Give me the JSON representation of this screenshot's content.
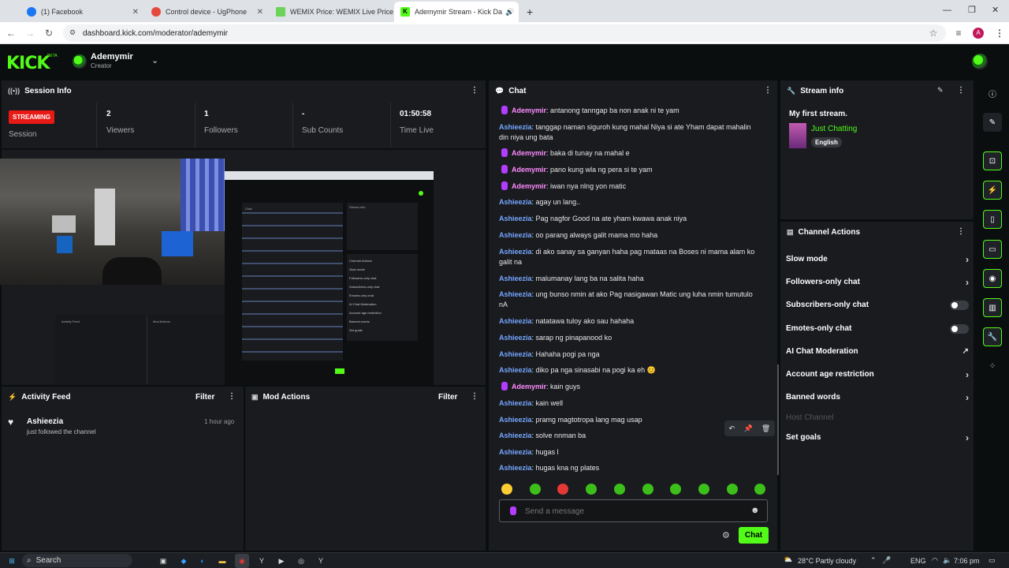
{
  "browser": {
    "tabs": [
      {
        "title": "(1) Facebook",
        "color": "#1877f2"
      },
      {
        "title": "Control device - UgPhone",
        "color": "#e64a3c"
      },
      {
        "title": "WEMIX Price: WEMIX Live Price",
        "color": "#6bd25a"
      },
      {
        "title": "Ademymir Stream - Kick Da",
        "color": "#53fc18"
      }
    ],
    "new_tab": "+",
    "url": "dashboard.kick.com/moderator/ademymir",
    "profile_initial": "A"
  },
  "header": {
    "logo": "KICK",
    "beta": "BETA",
    "channel_name": "Ademymir",
    "role": "Creator"
  },
  "session": {
    "title": "Session Info",
    "badge": "STREAMING",
    "session_label": "Session",
    "viewers_value": "2",
    "viewers_label": "Viewers",
    "followers_value": "1",
    "followers_label": "Followers",
    "subs_value": "-",
    "subs_label": "Sub Counts",
    "time_value": "01:50:58",
    "time_label": "Time Live"
  },
  "preview": {
    "mini_lines": [
      "Chat",
      "Stream info",
      "Channel Actions",
      "Activity Feed",
      "Mod Actions",
      "Slow mode",
      "Followers-only chat",
      "Subscribers-only chat",
      "Emotes-only chat",
      "AI Chat Moderation",
      "Account age restriction",
      "Banned words",
      "Set goals"
    ]
  },
  "activity": {
    "title": "Activity Feed",
    "filter": "Filter",
    "item_user": "Ashieezia",
    "item_time": "1 hour ago",
    "item_text": "just followed the channel"
  },
  "modactions": {
    "title": "Mod Actions",
    "filter": "Filter"
  },
  "chat": {
    "title": "Chat",
    "messages": [
      {
        "user": "Ademymir",
        "text": "antanong tanngap ba non anak ni te yam",
        "mod": true
      },
      {
        "user": "Ashieezia",
        "text": "tanggap naman siguroh kung mahal Niya si ate Yham dapat mahalin din niya ung bata",
        "mod": false
      },
      {
        "user": "Ademymir",
        "text": "baka di tunay na mahal e",
        "mod": true
      },
      {
        "user": "Ademymir",
        "text": "pano kung wla ng pera si te yam",
        "mod": true
      },
      {
        "user": "Ademymir",
        "text": "iwan nya nlng yon matic",
        "mod": true
      },
      {
        "user": "Ashieezia",
        "text": "agay un lang..",
        "mod": false
      },
      {
        "user": "Ashieezia",
        "text": "Pag nagfor Good na ate yham kwawa anak niya",
        "mod": false
      },
      {
        "user": "Ashieezia",
        "text": "oo parang always galit mama mo haha",
        "mod": false
      },
      {
        "user": "Ashieezia",
        "text": "di ako sanay sa ganyan haha pag mataas na Boses ni mama alam ko galit na",
        "mod": false
      },
      {
        "user": "Ashieezia",
        "text": "malumanay lang ba na salita haha",
        "mod": false
      },
      {
        "user": "Ashieezia",
        "text": "ung bunso nmin at ako Pag nasigawan Matic ung luha nmin tumutulo nA",
        "mod": false
      },
      {
        "user": "Ashieezia",
        "text": "natatawa tuloy ako sau hahaha",
        "mod": false
      },
      {
        "user": "Ashieezia",
        "text": "sarap ng pinapanood ko",
        "mod": false
      },
      {
        "user": "Ashieezia",
        "text": "Hahaha pogi pa nga",
        "mod": false
      },
      {
        "user": "Ashieezia",
        "text": "diko pa nga sinasabi na pogi ka eh 😊",
        "mod": false
      },
      {
        "user": "Ademymir",
        "text": "kain guys",
        "mod": true
      },
      {
        "user": "Ashieezia",
        "text": "kain well",
        "mod": false
      },
      {
        "user": "Ashieezia",
        "text": "pramg magtotropa lang mag usap",
        "mod": false
      },
      {
        "user": "Ashieezia",
        "text": "solve nnman ba",
        "mod": false
      },
      {
        "user": "Ashieezia",
        "text": "hugas l",
        "mod": false
      },
      {
        "user": "Ashieezia",
        "text": "hugas kna ng plates",
        "mod": false
      }
    ],
    "placeholder": "Send a message",
    "send_label": "Chat"
  },
  "stream_info": {
    "title": "Stream info",
    "stream_title": "My first stream.",
    "category": "Just Chatting",
    "language": "English"
  },
  "channel_actions": {
    "title": "Channel Actions",
    "items": [
      {
        "label": "Slow mode",
        "kind": "arrow"
      },
      {
        "label": "Followers-only chat",
        "kind": "arrow"
      },
      {
        "label": "Subscribers-only chat",
        "kind": "toggle"
      },
      {
        "label": "Emotes-only chat",
        "kind": "toggle"
      },
      {
        "label": "AI Chat Moderation",
        "kind": "external"
      },
      {
        "label": "Account age restriction",
        "kind": "arrow"
      },
      {
        "label": "Banned words",
        "kind": "arrow"
      },
      {
        "label": "Host Channel",
        "kind": "disabled"
      },
      {
        "label": "Set goals",
        "kind": "arrow"
      }
    ]
  },
  "taskbar": {
    "search": "Search",
    "weather": "28°C  Partly cloudy",
    "lang": "ENG",
    "time": "7:06 pm"
  },
  "colors": {
    "brand": "#53fc18",
    "live": "#e91916",
    "panel": "#191b1f"
  }
}
